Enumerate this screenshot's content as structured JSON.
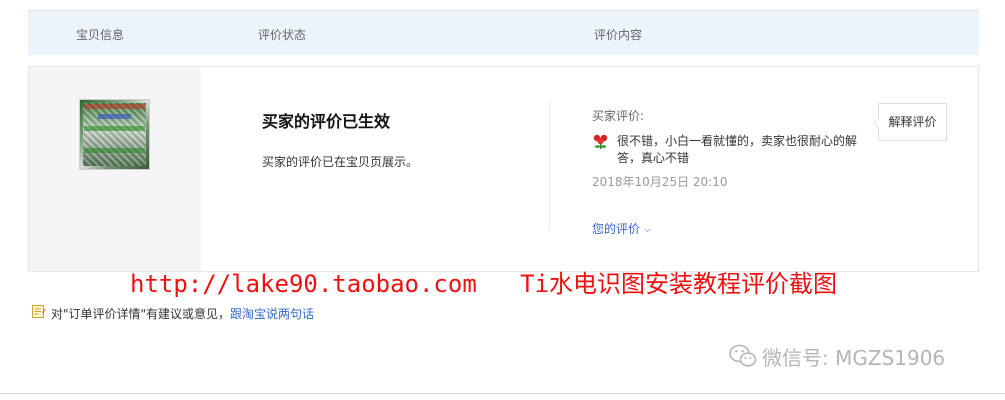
{
  "header": {
    "item_label": "宝贝信息",
    "status_label": "评价状态",
    "content_label": "评价内容"
  },
  "review": {
    "status_title": "买家的评价已生效",
    "status_desc": "买家的评价已在宝贝页展示。",
    "buyer_label": "买家评价:",
    "comment": "很不错，小白一看就懂的，卖家也很耐心的解答，真心不错",
    "date": "2018年10月25日 20:10",
    "your_review_label": "您的评价",
    "explain_button": "解释评价"
  },
  "watermark": {
    "red_text": "http://lake90.taobao.com   Ti水电识图安装教程评价截图",
    "wechat_text": "微信号: MGZS1906"
  },
  "feedback": {
    "prefix": "对\"订单评价详情\"有建议或意见，",
    "link": "跟淘宝说两句话"
  },
  "colors": {
    "header_bg": "#ebf3fb",
    "link": "#3366cc",
    "watermark_red": "#ee1111",
    "wechat_gray": "#b5b5b5"
  },
  "icons": {
    "flower": "rose-emoticon-icon",
    "feedback": "feedback-note-icon",
    "wechat": "wechat-logo-icon",
    "chevron": "chevron-down-icon"
  }
}
